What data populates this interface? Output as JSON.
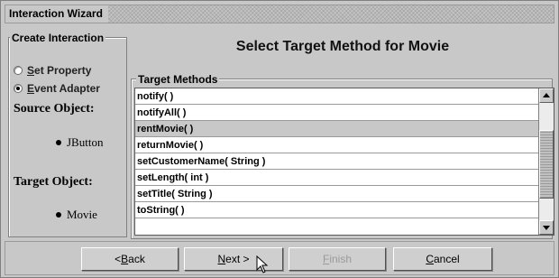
{
  "window": {
    "title": "Interaction Wizard"
  },
  "create_interaction": {
    "legend": "Create Interaction",
    "options": [
      {
        "label": "Set Property",
        "mnemonic": "S",
        "rest": "et Property",
        "checked": false
      },
      {
        "label": "Event Adapter",
        "mnemonic": "E",
        "rest": "vent Adapter",
        "checked": true
      }
    ]
  },
  "source": {
    "label": "Source Object:",
    "value": "JButton"
  },
  "target": {
    "label": "Target Object:",
    "value": "Movie"
  },
  "main": {
    "heading": "Select Target Method for Movie"
  },
  "methods": {
    "legend": "Target Methods",
    "items": [
      "notify( )",
      "notifyAll( )",
      "rentMovie( )",
      "returnMovie( )",
      "setCustomerName( String )",
      "setLength( int )",
      "setTitle( String )",
      "toString( )"
    ],
    "selected_index": 2,
    "scroll_position": 0.55
  },
  "buttons": {
    "back": {
      "label": "< Back",
      "prefix": "< ",
      "mnemonic": "B",
      "rest": "ack"
    },
    "next": {
      "label": "Next >",
      "mnemonic": "N",
      "rest": "ext >"
    },
    "finish": {
      "label": "Finish",
      "mnemonic": "F",
      "rest": "inish",
      "disabled": true
    },
    "cancel": {
      "label": "Cancel",
      "mnemonic": "C",
      "rest": "ancel"
    }
  },
  "icons": {
    "radio": "radio-button-icon",
    "bullet": "bullet-icon",
    "cursor": "mouse-pointer-icon"
  }
}
